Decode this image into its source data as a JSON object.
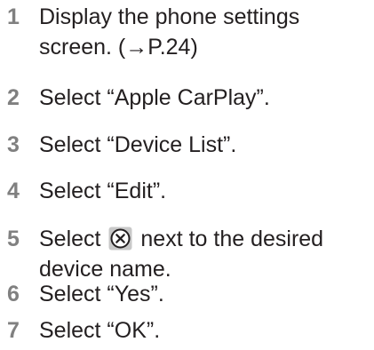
{
  "steps": [
    {
      "number": "1",
      "line1": "Display the phone settings",
      "line2": "screen. (→P.24)"
    },
    {
      "number": "2",
      "text": "Select “Apple CarPlay”."
    },
    {
      "number": "3",
      "text": "Select “Device List”."
    },
    {
      "number": "4",
      "text": "Select “Edit”."
    },
    {
      "number": "5",
      "before_icon": "Select",
      "icon": "delete-x-circle-icon",
      "after_icon": "next to the desired",
      "line2": "device name."
    },
    {
      "number": "6",
      "text": "Select “Yes”."
    },
    {
      "number": "7",
      "text": "Select “OK”."
    }
  ],
  "colors": {
    "step_number": "#808080",
    "body_text": "#231f20",
    "icon_fill": "#c8c8c8",
    "icon_border": "#231f20"
  }
}
